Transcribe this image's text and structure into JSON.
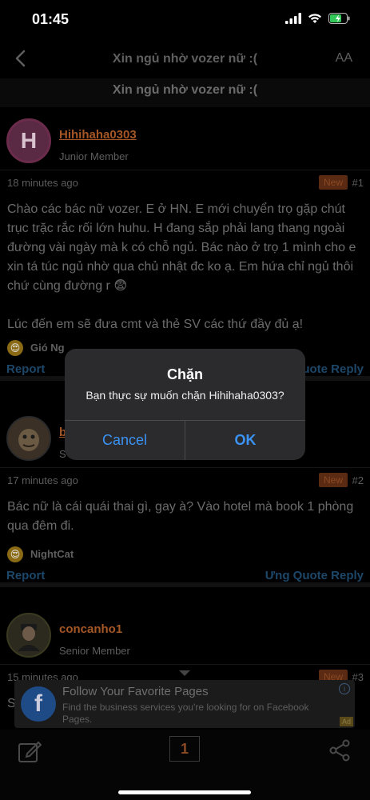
{
  "status_bar": {
    "time": "01:45"
  },
  "nav": {
    "title": "Xin ngủ nhờ vozer nữ :(",
    "text_size_label": "AA"
  },
  "thread": {
    "title": "Xin ngủ nhờ vozer nữ :("
  },
  "posts": [
    {
      "avatar_letter": "H",
      "username": "Hihihaha0303",
      "role": "Junior Member",
      "time": "18 minutes ago",
      "badge": "New",
      "number": "#1",
      "body": [
        "Chào các bác nữ vozer. E ở HN. E mới chuyển trọ gặp chút trục trặc rắc rối lớn huhu. H đang sắp phải lang thang ngoài đường vài ngày mà k có chỗ ngủ. Bác nào ở trọ 1 mình cho e xin tá túc ngủ nhờ qua chủ nhật đc ko ạ. Em hứa chỉ ngủ thôi chứ cùng đường r 😨",
        "Lúc đến em sẽ đưa cmt và thẻ SV các thứ đầy đủ ạ!"
      ],
      "reaction_user": "Gió Ng",
      "report_label": "Report",
      "quote_reply_label": "uote Reply"
    },
    {
      "avatar_letter": "",
      "username": "b",
      "role": "S",
      "time": "17 minutes ago",
      "badge": "New",
      "number": "#2",
      "body": [
        "Bác nữ là cái quái thai gì, gay à? Vào hotel mà book 1 phòng qua đêm đi."
      ],
      "reaction_user": "NightCat",
      "report_label": "Report",
      "quote_reply_label": "Ưng Quote Reply"
    },
    {
      "avatar_letter": "",
      "username": "concanho1",
      "role": "Senior Member",
      "time": "15 minutes ago",
      "badge": "New",
      "number": "#3",
      "body": [
        "S"
      ]
    }
  ],
  "ad": {
    "title": "Follow Your Favorite Pages",
    "description": "Find the business services you're looking for on Facebook Pages.",
    "tag": "Ad"
  },
  "toolbar": {
    "page_number": "1"
  },
  "alert": {
    "title": "Chặn",
    "message": "Bạn thực sự muốn chặn Hihihaha0303?",
    "cancel_label": "Cancel",
    "ok_label": "OK"
  },
  "colors": {
    "accent_link": "#3a93f5",
    "username": "#d9823f",
    "action_blue": "#4fa3e8"
  }
}
